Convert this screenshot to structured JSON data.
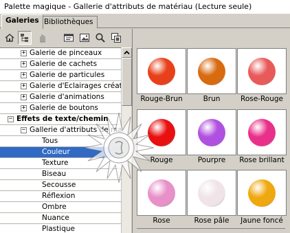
{
  "window": {
    "title": "Palette magique - Gallerie d'attributs de matériau (Lecture seule)"
  },
  "tabs": [
    {
      "label": "Galeries",
      "active": true
    },
    {
      "label": "Bibliothèques",
      "active": false
    }
  ],
  "toolbar": {
    "buttons": [
      {
        "icon": "home-icon"
      },
      {
        "icon": "tree-view-icon",
        "pressed": true
      },
      {
        "icon": "hand-icon"
      },
      {
        "icon": "panel-icon"
      },
      {
        "icon": "picture-icon"
      },
      {
        "icon": "search-icon"
      },
      {
        "icon": "copy-icon"
      }
    ]
  },
  "tree": {
    "items": [
      {
        "label": "Galerie de pinceaux",
        "expander": "+",
        "level": 1
      },
      {
        "label": "Galerie de cachets",
        "expander": "+",
        "level": 1
      },
      {
        "label": "Galerie de particules",
        "expander": "+",
        "level": 1
      },
      {
        "label": "Galerie d'Eclairages créatifs",
        "expander": "+",
        "level": 1
      },
      {
        "label": "Galerie d'animations",
        "expander": "+",
        "level": 1
      },
      {
        "label": "Galerie de boutons",
        "expander": "+",
        "level": 1
      },
      {
        "label": "Effets de texte/chemin",
        "expander": "−",
        "level": 0,
        "bold": true
      },
      {
        "label": "Gallerie d'attributs de matér",
        "expander": "−",
        "level": 1
      },
      {
        "label": "Tous",
        "level": 2
      },
      {
        "label": "Couleur",
        "level": 2,
        "selected": true
      },
      {
        "label": "Texture",
        "level": 2
      },
      {
        "label": "Biseau",
        "level": 2
      },
      {
        "label": "Secousse",
        "level": 2
      },
      {
        "label": "Réflexion",
        "level": 2
      },
      {
        "label": "Ombre",
        "level": 2
      },
      {
        "label": "Nuance",
        "level": 2
      },
      {
        "label": "Plastique",
        "level": 2
      }
    ]
  },
  "gallery": {
    "items": [
      {
        "label": "Rouge-Brun",
        "color": "#e8401a"
      },
      {
        "label": "Brun",
        "color": "#d86a10"
      },
      {
        "label": "Rose-Rouge",
        "color": "#e85a5a"
      },
      {
        "label": "Rouge",
        "color": "#e81010"
      },
      {
        "label": "Pourpre",
        "color": "#b050e0"
      },
      {
        "label": "Rose brillant",
        "color": "#e8308a"
      },
      {
        "label": "Rose",
        "color": "#e890c8"
      },
      {
        "label": "Rose pâle",
        "color": "#f0e4e8"
      },
      {
        "label": "Jaune foncé",
        "color": "#f0a810"
      }
    ]
  }
}
